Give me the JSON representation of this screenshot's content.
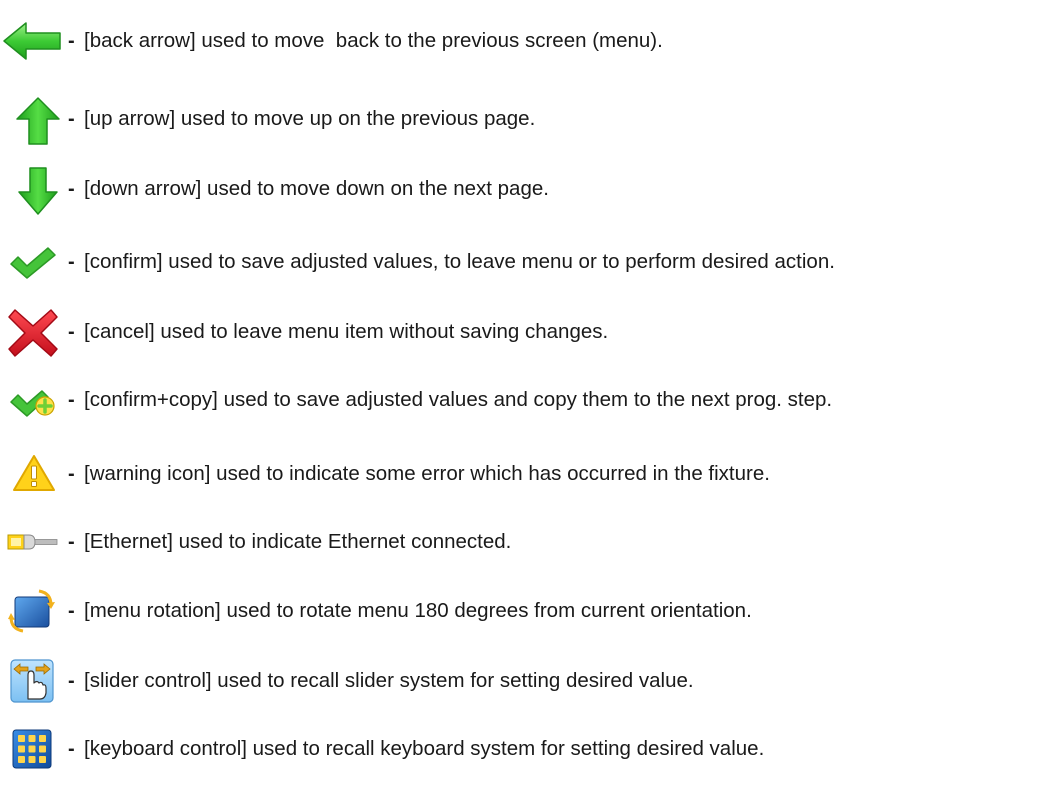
{
  "legend": {
    "separator": "-",
    "items": [
      {
        "icon": "back-arrow-icon",
        "text": "[back arrow] used to move  back to the previous screen (menu)."
      },
      {
        "icon": "up-arrow-icon",
        "text": "[up arrow] used to move up on the previous page."
      },
      {
        "icon": "down-arrow-icon",
        "text": "[down arrow] used to move down on the next page."
      },
      {
        "icon": "confirm-icon",
        "text": "[confirm] used to save adjusted values, to leave menu or to perform desired action."
      },
      {
        "icon": "cancel-icon",
        "text": "[cancel] used to leave menu item without saving changes."
      },
      {
        "icon": "confirm-copy-icon",
        "text": "[confirm+copy] used to save adjusted values and copy them to the next prog. step."
      },
      {
        "icon": "warning-icon",
        "text": "[warning icon] used to indicate some error which has occurred in the fixture."
      },
      {
        "icon": "ethernet-icon",
        "text": "[Ethernet] used to indicate Ethernet connected."
      },
      {
        "icon": "menu-rotation-icon",
        "text": "[menu rotation] used to rotate menu 180 degrees from current orientation."
      },
      {
        "icon": "slider-control-icon",
        "text": "[slider control] used to recall slider system for setting desired value."
      },
      {
        "icon": "keyboard-control-icon",
        "text": "[keyboard control] used to recall keyboard system for setting desired value."
      }
    ]
  },
  "colors": {
    "arrow_green": "#39c83a",
    "check_green": "#3fbf2f",
    "cancel_red": "#e01e2b",
    "warning_yellow": "#ffd21a",
    "keypad_blue": "#1c6fd1"
  }
}
